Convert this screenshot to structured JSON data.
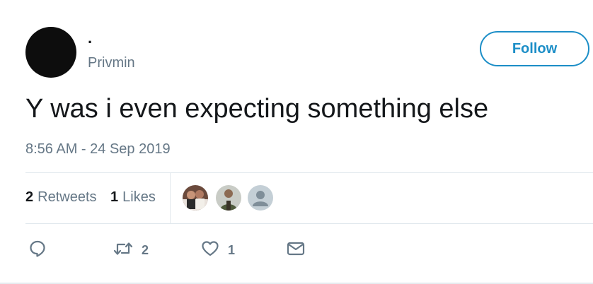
{
  "user": {
    "display_name": ".",
    "handle": "Privmin",
    "avatar_icon": "avatar-dark"
  },
  "follow_button": {
    "label": "Follow",
    "color": "#1c8ec7"
  },
  "tweet": {
    "text": "Y was i even expecting something else",
    "timestamp": "8:56 AM - 24 Sep 2019"
  },
  "stats": {
    "retweets_count": "2",
    "retweets_label": "Retweets",
    "likes_count": "1",
    "likes_label": "Likes"
  },
  "likers": [
    {
      "icon": "liker-avatar-photo-1"
    },
    {
      "icon": "liker-avatar-photo-2"
    },
    {
      "icon": "default-user-avatar"
    }
  ],
  "actions": {
    "reply": {
      "icon": "reply-icon"
    },
    "retweet": {
      "icon": "retweet-icon",
      "count": "2"
    },
    "like": {
      "icon": "heart-icon",
      "count": "1"
    },
    "dm": {
      "icon": "envelope-icon"
    }
  },
  "colors": {
    "text_primary": "#14171a",
    "text_secondary": "#657786",
    "divider": "#e1e8ed"
  }
}
